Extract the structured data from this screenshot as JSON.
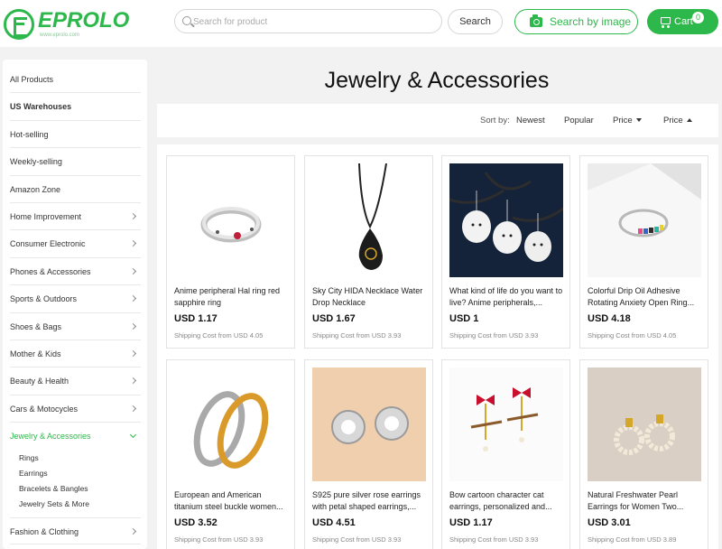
{
  "brand": {
    "name": "EPROLO",
    "sub": "www.eprolo.com",
    "color": "#2cb84a"
  },
  "header": {
    "search_placeholder": "Search for product",
    "search_button": "Search",
    "image_search_button": "Search by image",
    "cart_label": "Cart",
    "cart_count": "0"
  },
  "sidebar": {
    "items": [
      {
        "label": "All Products",
        "chevron": false
      },
      {
        "label": "US Warehouses",
        "chevron": false,
        "bold": true
      },
      {
        "label": "Hot-selling",
        "chevron": false
      },
      {
        "label": "Weekly-selling",
        "chevron": false
      },
      {
        "label": "Amazon Zone",
        "chevron": false
      },
      {
        "label": "Home Improvement",
        "chevron": true
      },
      {
        "label": "Consumer Electronic",
        "chevron": true
      },
      {
        "label": "Phones & Accessories",
        "chevron": true
      },
      {
        "label": "Sports & Outdoors",
        "chevron": true
      },
      {
        "label": "Shoes & Bags",
        "chevron": true
      },
      {
        "label": "Mother & Kids",
        "chevron": true
      },
      {
        "label": "Beauty & Health",
        "chevron": true
      },
      {
        "label": "Cars & Motocycles",
        "chevron": true
      },
      {
        "label": "Jewelry & Accessories",
        "chevron": true,
        "active": true
      }
    ],
    "subitems": [
      "Rings",
      "Earrings",
      "Bracelets & Bangles",
      "Jewelry Sets & More"
    ],
    "after": {
      "label": "Fashion & Clothing",
      "chevron": true
    }
  },
  "page_title": "Jewelry & Accessories",
  "sort": {
    "label": "Sort by:",
    "options": [
      "Newest",
      "Popular",
      "Price",
      "Price"
    ]
  },
  "products": [
    {
      "name": "Anime peripheral Hal ring red sapphire ring",
      "price": "USD 1.17",
      "shipping": "Shipping Cost from USD 4.05"
    },
    {
      "name": "Sky City HIDA Necklace Water Drop Necklace",
      "price": "USD 1.67",
      "shipping": "Shipping Cost from USD 3.93"
    },
    {
      "name": "What kind of life do you want to live? Anime peripherals,...",
      "price": "USD 1",
      "shipping": "Shipping Cost from USD 3.93"
    },
    {
      "name": "Colorful Drip Oil Adhesive Rotating Anxiety Open Ring...",
      "price": "USD 4.18",
      "shipping": "Shipping Cost from USD 4.05"
    },
    {
      "name": "European and American titanium steel buckle women...",
      "price": "USD 3.52",
      "shipping": "Shipping Cost from USD 3.93"
    },
    {
      "name": "S925 pure silver rose earrings with petal shaped earrings,...",
      "price": "USD 4.51",
      "shipping": "Shipping Cost from USD 3.93"
    },
    {
      "name": "Bow cartoon character cat earrings, personalized and...",
      "price": "USD 1.17",
      "shipping": "Shipping Cost from USD 3.93"
    },
    {
      "name": "Natural Freshwater Pearl Earrings for Women Two...",
      "price": "USD 3.01",
      "shipping": "Shipping Cost from USD 3.89"
    }
  ]
}
